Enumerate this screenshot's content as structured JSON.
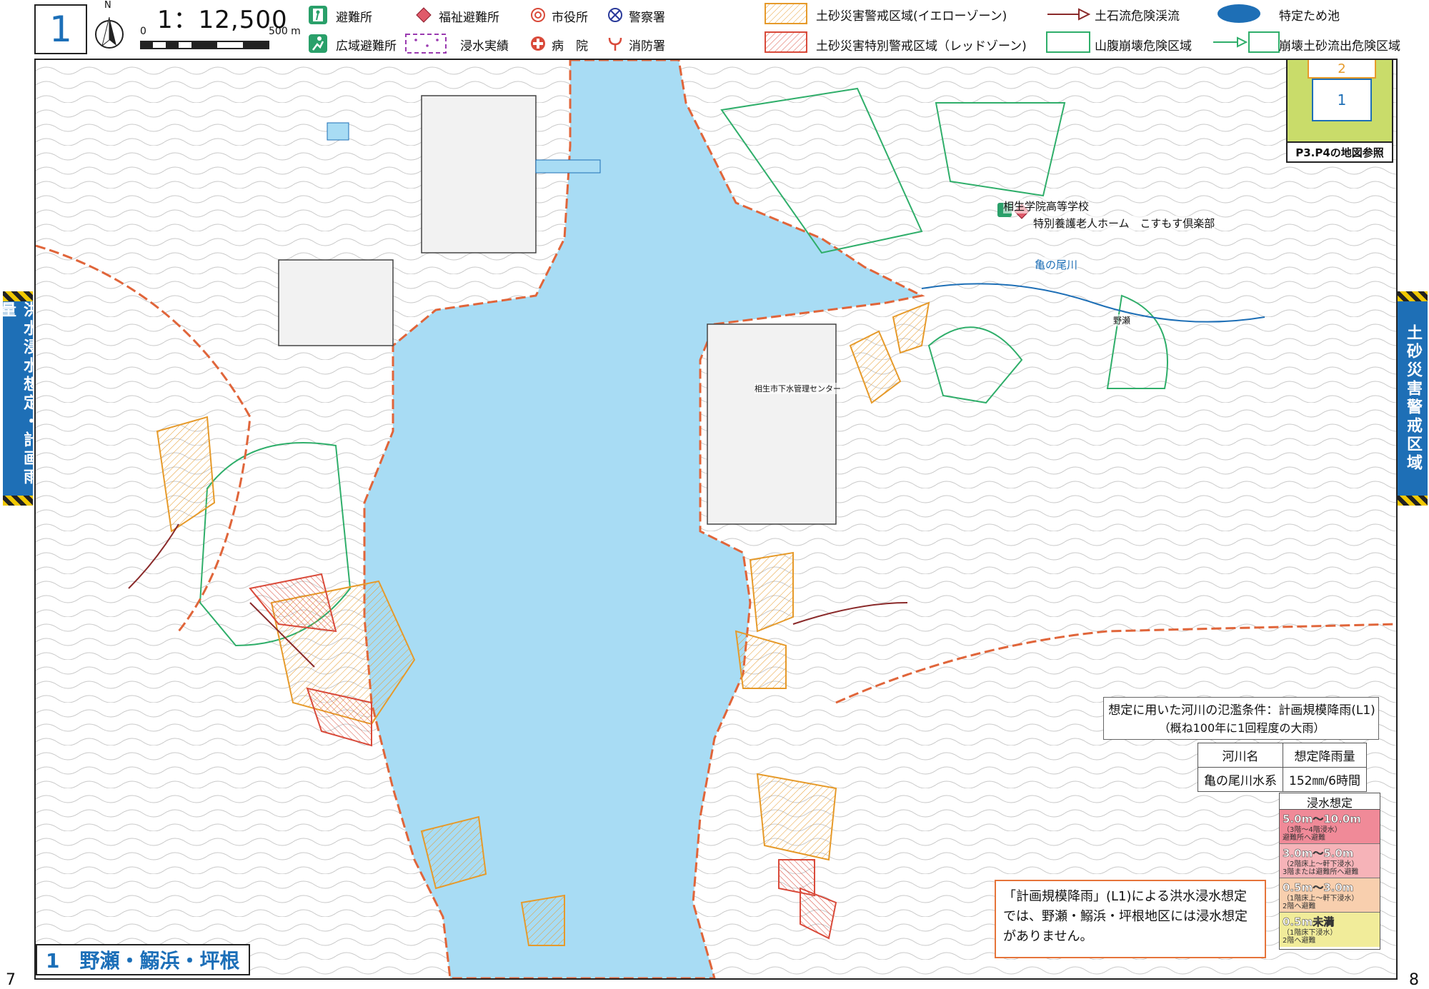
{
  "header": {
    "sheet_number": "1",
    "scale": "1：12,500",
    "scalebar_zero": "0",
    "scalebar_max": "500 m",
    "north_label": "N"
  },
  "legend": {
    "evacuation_site": "避難所",
    "wide_evacuation_site": "広域避難所",
    "welfare_evacuation_site": "福祉避難所",
    "flood_record": "浸水実績",
    "city_hall": "市役所",
    "hospital": "病　院",
    "police": "警察署",
    "fire_station": "消防署",
    "yellow_zone": "土砂災害警戒区域(イエローゾーン)",
    "red_zone": "土砂災害特別警戒区域（レッドゾーン)",
    "debris_flow_stream": "土石流危険渓流",
    "slope_collapse_area": "山腹崩壊危険区域",
    "designated_pond": "特定ため池",
    "collapse_debris_area": "崩壊土砂流出危険区域"
  },
  "colors": {
    "sea": "#a8dcf4",
    "yellow_zone": "#e69a2a",
    "red_zone": "#d94a3a",
    "slope_collapse": "#2fae6a",
    "debris_flow": "#8a2a2a",
    "boundary": "#e0653a",
    "accent_blue": "#1e6fb6"
  },
  "side_tabs": {
    "left": "洪水浸水想定・計画雨量",
    "right": "土砂災害警戒区域"
  },
  "index_map": {
    "box1": "1",
    "box2": "2",
    "caption": "P3.P4の地図参照"
  },
  "map_labels": {
    "school": "相生学院高等学校",
    "nursing_home": "特別養護老人ホーム　こすもす倶楽部",
    "river": "亀の尾川",
    "district": "野瀬",
    "sewage_center": "相生市下水管理センター"
  },
  "conditions": {
    "line1": "想定に用いた河川の氾濫条件：計画規模降雨(L1)",
    "line2": "（概ね100年に1回程度の大雨）",
    "table_header": [
      "河川名",
      "想定降雨量"
    ],
    "table_row": [
      "亀の尾川水系",
      "152㎜/6時間"
    ]
  },
  "depth_legend": {
    "title": "浸水想定",
    "rows": [
      {
        "main": "5.0m～10.0m",
        "sub1": "（3階～4階浸水）",
        "sub2": "避難所へ避難",
        "color": "#f08a98"
      },
      {
        "main": "3.0m～5.0m",
        "sub1": "（2階床上～軒下浸水）",
        "sub2": "3階または避難所へ避難",
        "color": "#f6b3b8"
      },
      {
        "main": "0.5m～3.0m",
        "sub1": "（1階床上～軒下浸水）",
        "sub2": "2階へ避難",
        "color": "#f8cfae"
      },
      {
        "main": "0.5m未満",
        "sub1": "（1階床下浸水）",
        "sub2": "2階へ避難",
        "color": "#f1ec9a"
      }
    ]
  },
  "note": "「計画規模降雨」(L1)による洪水浸水想定では、野瀬・鰯浜・坪根地区には浸水想定がありません。",
  "region_title": "1　野瀬・鰯浜・坪根",
  "page_numbers": {
    "left": "7",
    "right": "8"
  }
}
